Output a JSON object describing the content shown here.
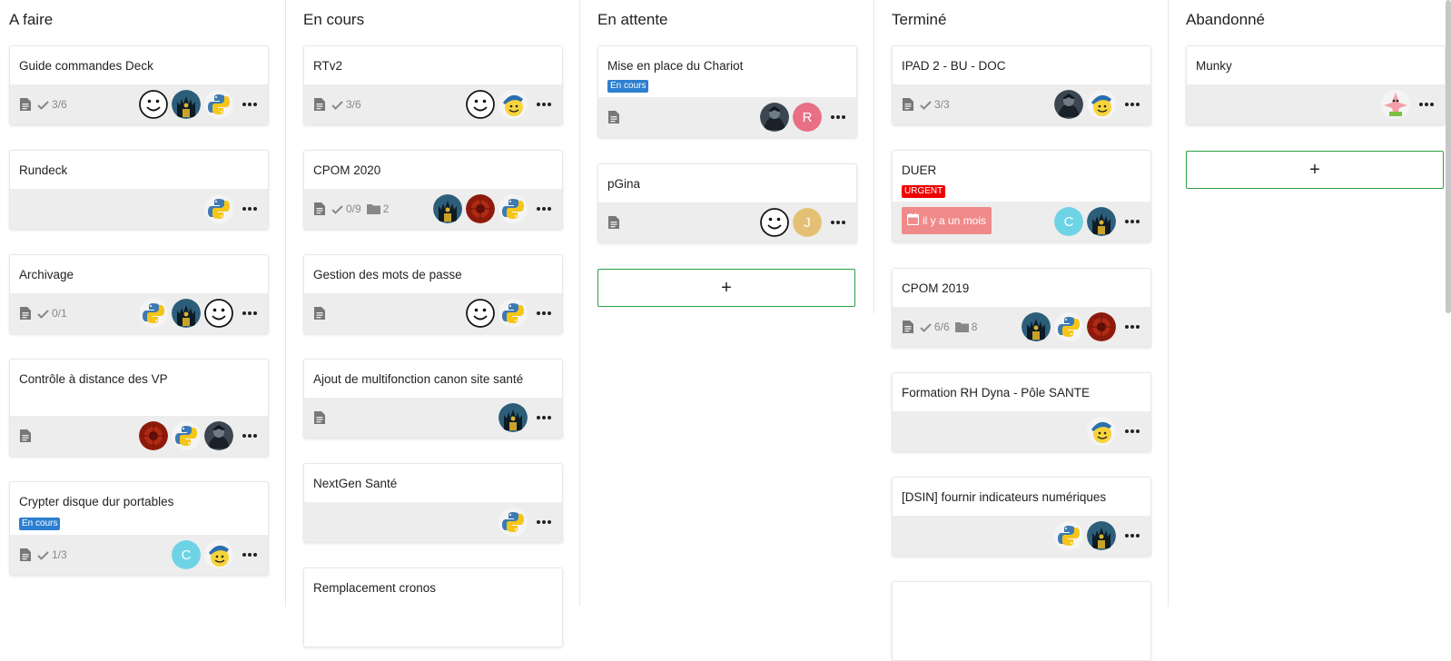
{
  "stacks": [
    {
      "title": "A faire",
      "cards": [
        {
          "title": "Guide commandes Deck",
          "checklist": "3/6"
        },
        {
          "title": "Rundeck"
        },
        {
          "title": "Archivage",
          "checklist": "0/1"
        },
        {
          "title": "Contrôle à distance des VP"
        },
        {
          "title": "Crypter disque dur portables",
          "label": "En cours",
          "checklist": "1/3"
        }
      ]
    },
    {
      "title": "En cours",
      "cards": [
        {
          "title": "RTv2",
          "checklist": "3/6"
        },
        {
          "title": "CPOM 2020",
          "checklist": "0/9",
          "attachments": "2"
        },
        {
          "title": "Gestion des mots de passe"
        },
        {
          "title": "Ajout de multifonction canon site santé"
        },
        {
          "title": "NextGen Santé"
        },
        {
          "title": "Remplacement cronos"
        }
      ]
    },
    {
      "title": "En attente",
      "cards": [
        {
          "title": "Mise en place du Chariot",
          "label": "En cours"
        },
        {
          "title": "pGina"
        }
      ],
      "add_label": "+"
    },
    {
      "title": "Terminé",
      "cards": [
        {
          "title": "IPAD 2 - BU - DOC",
          "checklist": "3/3"
        },
        {
          "title": "DUER",
          "label": "URGENT",
          "due": "il y a un mois"
        },
        {
          "title": "CPOM 2019",
          "checklist": "6/6",
          "attachments": "8"
        },
        {
          "title": "Formation RH Dyna - Pôle SANTE"
        },
        {
          "title": "[DSIN] fournir indicateurs numériques"
        }
      ]
    },
    {
      "title": "Abandonné",
      "cards": [
        {
          "title": "Munky"
        }
      ],
      "add_label": "+"
    }
  ],
  "avatar_letters": {
    "c": "C",
    "r": "R",
    "j": "J"
  },
  "colors": {
    "label_blue": "#2d7fd0",
    "label_red": "#ee0000",
    "due_bg": "#f08a8a",
    "add_border": "#2ea043",
    "footer_bg": "#ededed",
    "avatar_c": "#6fd3e6",
    "avatar_r": "#e86f85",
    "avatar_j": "#e4c074"
  },
  "icons": [
    "description-icon",
    "check-icon",
    "folder-icon",
    "calendar-icon",
    "more-icon",
    "python-avatar",
    "smiley-avatar",
    "throne-avatar",
    "dark-avatar",
    "red-avatar",
    "hat-avatar",
    "patrick-avatar",
    "letter-avatar"
  ]
}
